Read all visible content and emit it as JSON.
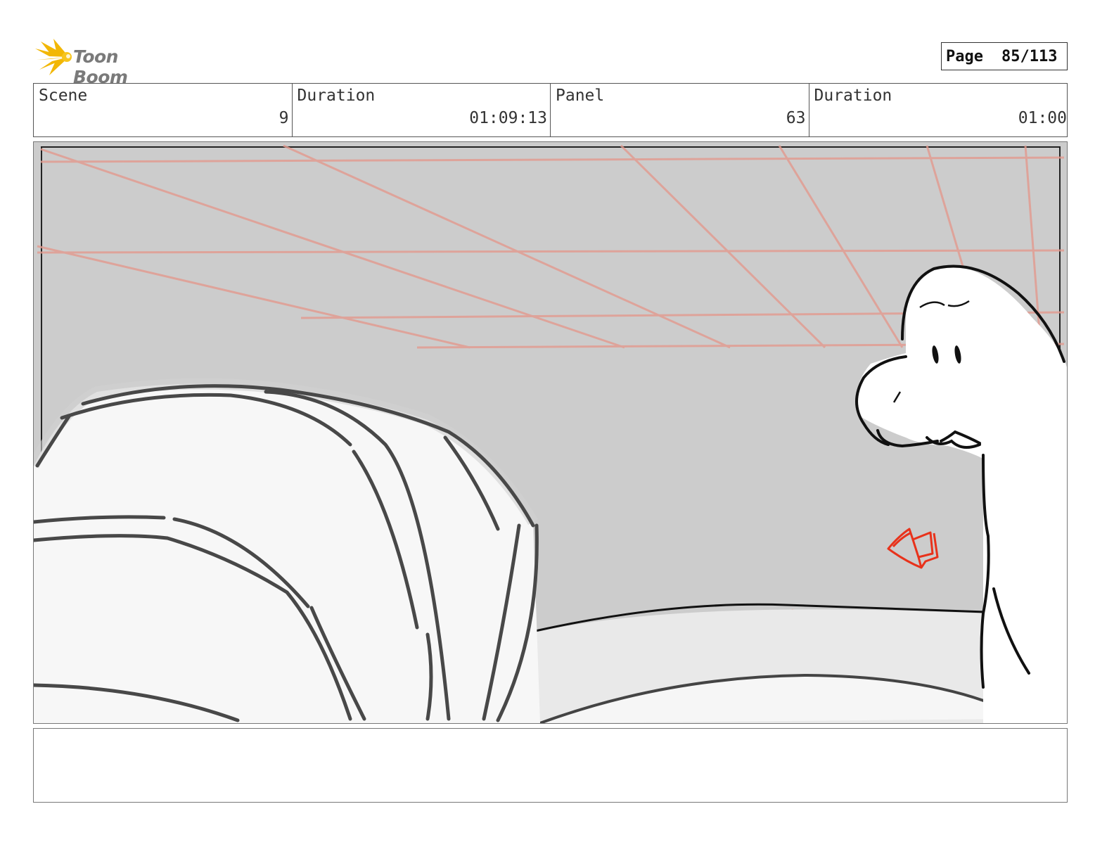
{
  "brand": {
    "name": "Toon Boom",
    "accent": "#f2b705"
  },
  "page": {
    "label": "Page",
    "value": "85/113"
  },
  "info": [
    {
      "key": "Scene",
      "value": "9"
    },
    {
      "key": "Duration",
      "value": "01:09:13"
    },
    {
      "key": "Panel",
      "value": "63"
    },
    {
      "key": "Duration",
      "value": "01:00"
    }
  ],
  "panel": {
    "background": "#cccccc",
    "guide_color": "#e39a8e",
    "arrow_color": "#e8321b",
    "icon": "red-motion-arrow-icon"
  },
  "notes": {
    "text": ""
  }
}
